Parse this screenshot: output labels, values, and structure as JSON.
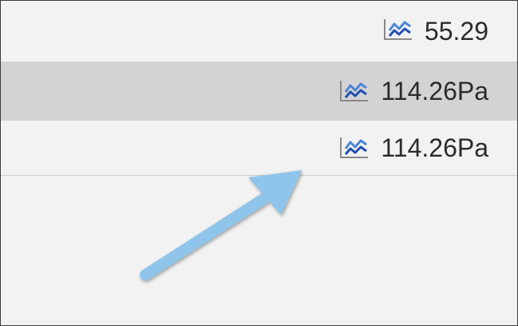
{
  "readings": [
    {
      "value": "55.29",
      "icon": "trend-chart-icon"
    },
    {
      "value": "114.26Pa",
      "icon": "trend-chart-icon"
    },
    {
      "value": "114.26Pa",
      "icon": "trend-chart-icon"
    }
  ],
  "annotation": {
    "icon": "arrow-pointer-icon",
    "color": "#8fc5ea"
  },
  "colors": {
    "background": "#f2f2f2",
    "selected_row": "#d3d3d3",
    "icon_line_dark": "#1f4fb0",
    "icon_line_light": "#4a86d4"
  }
}
